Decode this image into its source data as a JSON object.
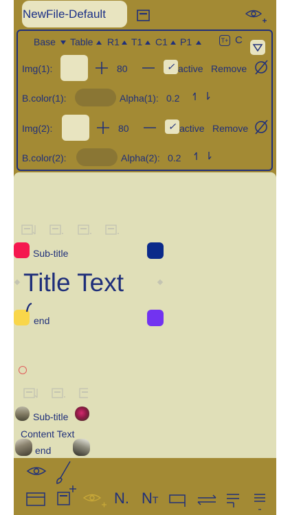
{
  "file": {
    "name": "NewFile-Default"
  },
  "tabs": [
    {
      "label": "Base",
      "arrow": "down"
    },
    {
      "label": "Table",
      "arrow": "up"
    },
    {
      "label": "R1",
      "arrow": "up"
    },
    {
      "label": "T1",
      "arrow": "up"
    },
    {
      "label": "C1",
      "arrow": "up"
    },
    {
      "label": "P1",
      "arrow": "up"
    }
  ],
  "tab_icons": {
    "t_plus": "T+",
    "c_icon": "C"
  },
  "rows": {
    "img1": {
      "label": "Img(1):",
      "value": "80",
      "active_label": "active",
      "remove_label": "Remove",
      "checked": "✓"
    },
    "bcolor1": {
      "label": "B.color(1):",
      "alpha_label": "Alpha(1):",
      "alpha_value": "0.2"
    },
    "img2": {
      "label": "Img(2):",
      "value": "80",
      "active_label": "active",
      "remove_label": "Remove",
      "checked": "✓"
    },
    "bcolor2": {
      "label": "B.color(2):",
      "alpha_label": "Alpha(2):",
      "alpha_value": "0.2"
    }
  },
  "canvas": {
    "section1": {
      "subtitle": "Sub-title",
      "title": "Title Text",
      "end": "end"
    },
    "section2": {
      "subtitle": "Sub-title",
      "content": "Content Text",
      "end": "end"
    }
  },
  "colors": {
    "frame": "#a38a34",
    "canvas": "#e0dfb8",
    "accent": "#1f2f7a",
    "red": "#f5184f",
    "navy": "#0b2a8a",
    "yellow": "#f9d64a",
    "purple": "#7233f0"
  }
}
